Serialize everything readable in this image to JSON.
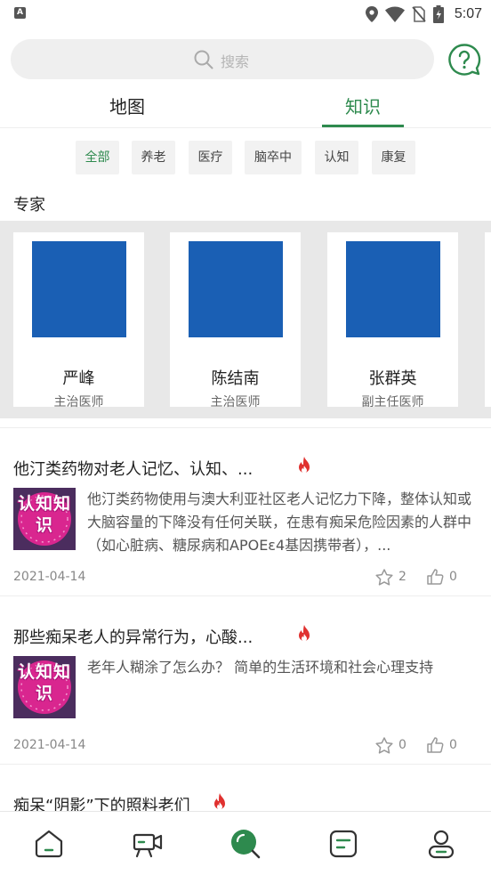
{
  "status_bar": {
    "time": "5:07",
    "left_badge": "A",
    "icons": [
      "location-icon",
      "wifi-icon",
      "no-sim-icon",
      "battery-icon"
    ]
  },
  "search": {
    "placeholder": "搜索",
    "help_icon": "question-circle-icon"
  },
  "tabs": [
    {
      "label": "地图",
      "active": false
    },
    {
      "label": "知识",
      "active": true
    }
  ],
  "filters": [
    {
      "label": "全部",
      "active": true
    },
    {
      "label": "养老",
      "active": false
    },
    {
      "label": "医疗",
      "active": false
    },
    {
      "label": "脑卒中",
      "active": false
    },
    {
      "label": "认知",
      "active": false
    },
    {
      "label": "康复",
      "active": false
    }
  ],
  "experts_section": {
    "title": "专家",
    "experts": [
      {
        "name": "严峰",
        "title": "主治医师"
      },
      {
        "name": "陈结南",
        "title": "主治医师"
      },
      {
        "name": "张群英",
        "title": "副主任医师"
      }
    ]
  },
  "articles": [
    {
      "title": "他汀类药物对老人记忆、认知、...",
      "thumbnail_text": "认知知识",
      "summary": "他汀类药物使用与澳大利亚社区老人记忆力下降，整体认知或大脑容量的下降没有任何关联，在患有痴呆危险因素的人群中（如心脏病、糖尿病和APOEε4基因携带者），...",
      "date": "2021-04-14",
      "stars": "2",
      "likes": "0",
      "hot": true
    },
    {
      "title": "那些痴呆老人的异常行为，心酸...",
      "thumbnail_text": "认知知识",
      "summary": "老年人糊涂了怎么办？ 简单的生活环境和社会心理支持",
      "date": "2021-04-14",
      "stars": "0",
      "likes": "0",
      "hot": true
    },
    {
      "title": "痴呆“阴影”下的照料老们",
      "hot": true
    }
  ],
  "bottom_nav": [
    {
      "icon": "home-icon",
      "active": false
    },
    {
      "icon": "video-camera-icon",
      "active": false
    },
    {
      "icon": "discover-search-icon",
      "active": true
    },
    {
      "icon": "notes-icon",
      "active": false
    },
    {
      "icon": "user-icon",
      "active": false
    }
  ],
  "colors": {
    "accent": "#2e8a4e",
    "hot": "#e0312f",
    "expert_photo": "#1a5fb4"
  }
}
